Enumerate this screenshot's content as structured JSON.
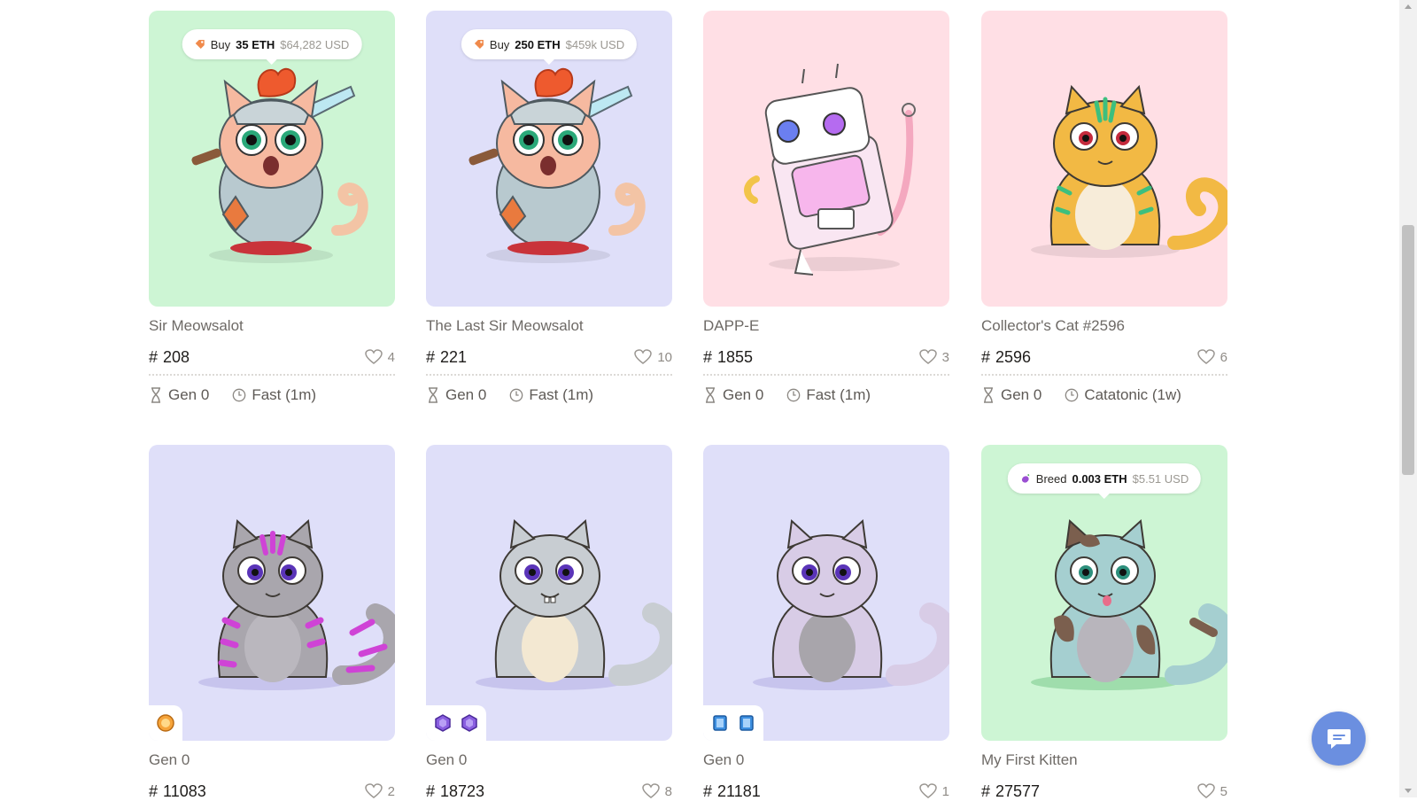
{
  "colors": {
    "tile_green": "#cdf5d4",
    "tile_lavender": "#dfdff9",
    "tile_pink": "#ffdfe5",
    "chat_button": "#6b8fe0",
    "text_primary": "#1f1d1b",
    "text_muted": "#8f8b86"
  },
  "cats": [
    {
      "name": "Sir Meowsalot",
      "id": "208",
      "likes": "4",
      "gen": "Gen 0",
      "speed": "Fast (1m)",
      "tile_color": "green",
      "art": "knight-cat",
      "offer": {
        "label": "Buy",
        "amount": "35 ETH",
        "usd": "$64,282 USD",
        "icon": "price-tag-icon"
      }
    },
    {
      "name": "The Last Sir Meowsalot",
      "id": "221",
      "likes": "10",
      "gen": "Gen 0",
      "speed": "Fast (1m)",
      "tile_color": "lavender",
      "art": "knight-cat",
      "offer": {
        "label": "Buy",
        "amount": "250 ETH",
        "usd": "$459k USD",
        "icon": "price-tag-icon"
      }
    },
    {
      "name": "DAPP-E",
      "id": "1855",
      "likes": "3",
      "gen": "Gen 0",
      "speed": "Fast (1m)",
      "tile_color": "pink",
      "art": "robot-cat"
    },
    {
      "name": "Collector's Cat #2596",
      "id": "2596",
      "likes": "6",
      "gen": "Gen 0",
      "speed": "Catatonic (1w)",
      "tile_color": "pink",
      "art": "orange-green-cat"
    },
    {
      "name": "Gen 0",
      "id": "11083",
      "likes": "2",
      "tile_color": "lavender",
      "art": "gray-magenta-cat",
      "badges": [
        "sun-gem-icon"
      ]
    },
    {
      "name": "Gen 0",
      "id": "18723",
      "likes": "8",
      "tile_color": "lavender",
      "art": "silver-cat",
      "badges": [
        "purple-gem-icon",
        "purple-gem-icon"
      ]
    },
    {
      "name": "Gen 0",
      "id": "21181",
      "likes": "1",
      "tile_color": "lavender",
      "art": "lilac-cat",
      "badges": [
        "blue-book-icon",
        "blue-book-icon"
      ]
    },
    {
      "name": "My First Kitten",
      "id": "27577",
      "likes": "5",
      "tile_color": "green",
      "art": "calico-cat",
      "offer": {
        "label": "Breed",
        "amount": "0.003 ETH",
        "usd": "$5.51 USD",
        "icon": "eggplant-icon"
      }
    }
  ],
  "hash_symbol": "#",
  "chat": {
    "icon": "chat-bubble-icon"
  }
}
